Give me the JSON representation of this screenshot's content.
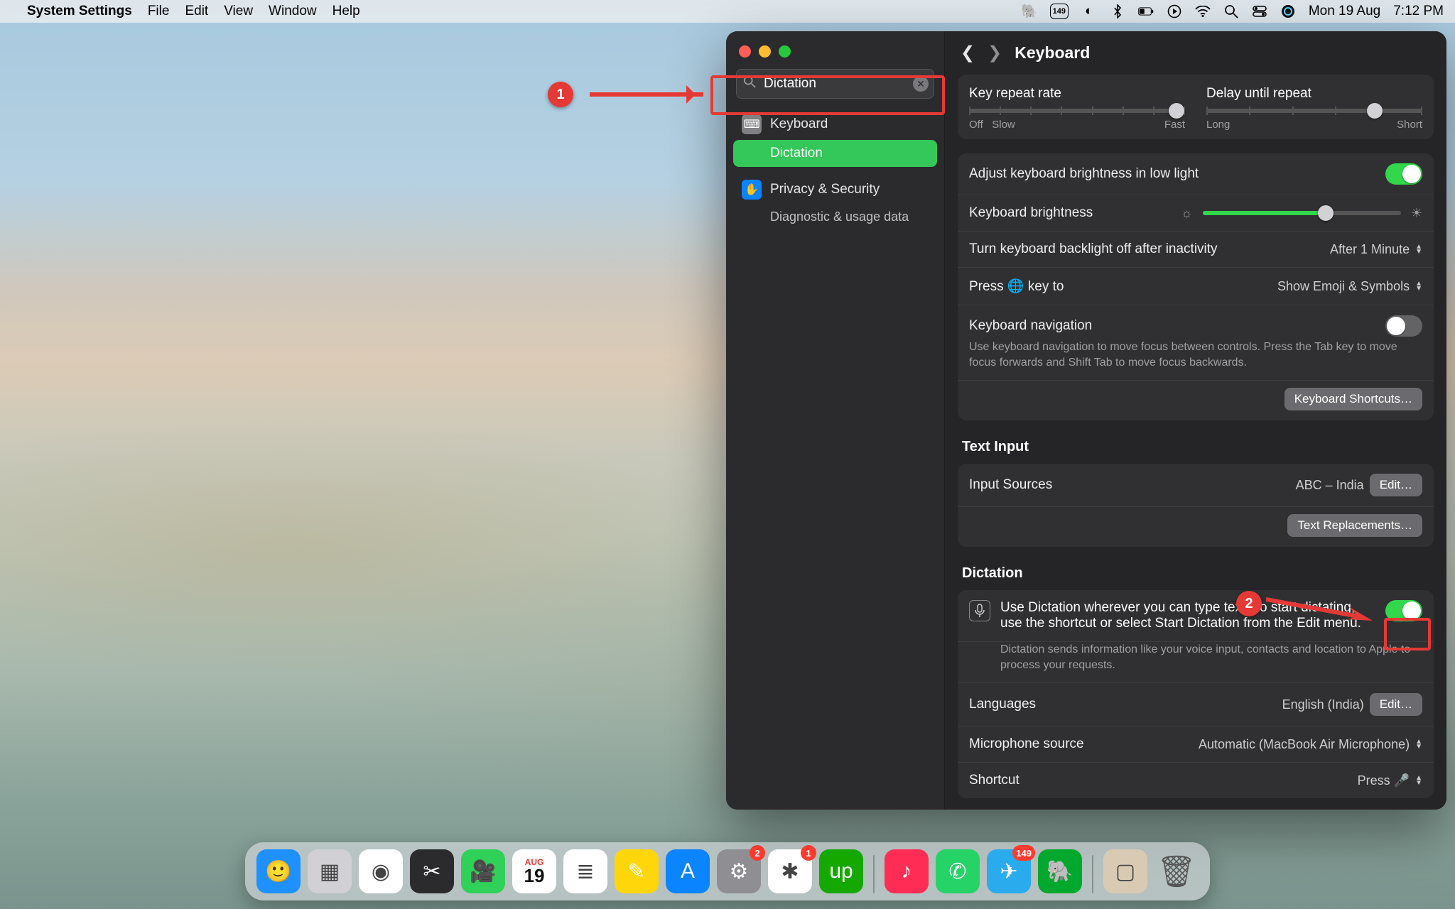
{
  "menubar": {
    "app_name": "System Settings",
    "menus": [
      "File",
      "Edit",
      "View",
      "Window",
      "Help"
    ],
    "status_badge": "149",
    "date": "Mon 19 Aug",
    "time": "7:12 PM"
  },
  "window": {
    "title": "Keyboard",
    "search_value": "Dictation",
    "sidebar": {
      "items": [
        {
          "icon": "keyboard",
          "label": "Keyboard",
          "selected": false
        },
        {
          "icon": "keyboard",
          "label": "Dictation",
          "selected": true
        },
        {
          "icon": "hand",
          "label": "Privacy & Security",
          "selected": false
        }
      ],
      "sub_item": "Diagnostic & usage data"
    }
  },
  "keyboard": {
    "key_repeat_label": "Key repeat rate",
    "key_repeat_left": "Off",
    "key_repeat_left2": "Slow",
    "key_repeat_right": "Fast",
    "key_repeat_pos_pct": 96,
    "delay_label": "Delay until repeat",
    "delay_left": "Long",
    "delay_right": "Short",
    "delay_pos_pct": 78,
    "adjust_brightness_label": "Adjust keyboard brightness in low light",
    "adjust_brightness_on": true,
    "brightness_label": "Keyboard brightness",
    "brightness_pct": 62,
    "backlight_off_label": "Turn keyboard backlight off after inactivity",
    "backlight_off_value": "After 1 Minute",
    "press_globe_label": "Press 🌐 key to",
    "press_globe_value": "Show Emoji & Symbols",
    "nav_label": "Keyboard navigation",
    "nav_on": false,
    "nav_desc": "Use keyboard navigation to move focus between controls. Press the Tab key to move focus forwards and Shift Tab to move focus backwards.",
    "shortcuts_btn": "Keyboard Shortcuts…"
  },
  "text_input": {
    "heading": "Text Input",
    "input_sources_label": "Input Sources",
    "input_sources_value": "ABC – India",
    "edit_btn": "Edit…",
    "replacements_btn": "Text Replacements…"
  },
  "dictation": {
    "heading": "Dictation",
    "toggle_on": true,
    "desc": "Use Dictation wherever you can type text. To start dictating, use the shortcut or select Start Dictation from the Edit menu.",
    "privacy": "Dictation sends information like your voice input, contacts and location to Apple to process your requests.",
    "languages_label": "Languages",
    "languages_value": "English (India)",
    "languages_edit": "Edit…",
    "mic_label": "Microphone source",
    "mic_value": "Automatic (MacBook Air Microphone)",
    "shortcut_label": "Shortcut",
    "shortcut_value": "Press 🎤"
  },
  "dock": {
    "apps": [
      {
        "name": "Finder",
        "bg": "#1e90ff",
        "glyph": "🙂"
      },
      {
        "name": "Launchpad",
        "bg": "#d0d0d5",
        "glyph": "▦"
      },
      {
        "name": "Chrome",
        "bg": "#ffffff",
        "glyph": "◉"
      },
      {
        "name": "FinalCut",
        "bg": "#2b2b2e",
        "glyph": "✂"
      },
      {
        "name": "FaceTime",
        "bg": "#30d158",
        "glyph": "🎥"
      },
      {
        "name": "Calendar",
        "bg": "#ffffff",
        "glyph": "",
        "cal_month": "AUG",
        "cal_day": "19"
      },
      {
        "name": "Reminders",
        "bg": "#ffffff",
        "glyph": "≣"
      },
      {
        "name": "Notes",
        "bg": "#ffd60a",
        "glyph": "✎"
      },
      {
        "name": "AppStore",
        "bg": "#0a84ff",
        "glyph": "A"
      },
      {
        "name": "Settings",
        "bg": "#8e8e93",
        "glyph": "⚙",
        "badge": "2"
      },
      {
        "name": "Slack",
        "bg": "#ffffff",
        "glyph": "✱",
        "badge": "1"
      },
      {
        "name": "Upwork",
        "bg": "#14a800",
        "glyph": "up"
      }
    ],
    "apps2": [
      {
        "name": "Music",
        "bg": "#ff2d55",
        "glyph": "♪"
      },
      {
        "name": "WhatsApp",
        "bg": "#25d366",
        "glyph": "✆"
      },
      {
        "name": "Telegram",
        "bg": "#2aabee",
        "glyph": "✈",
        "badge": "149"
      },
      {
        "name": "Evernote",
        "bg": "#00a82d",
        "glyph": "🐘"
      }
    ],
    "apps3": [
      {
        "name": "Preview",
        "bg": "#d9cbb3",
        "glyph": "▢"
      },
      {
        "name": "Trash",
        "bg": "transparent",
        "glyph": "🗑"
      }
    ]
  },
  "annotations": {
    "c1": "1",
    "c2": "2"
  }
}
